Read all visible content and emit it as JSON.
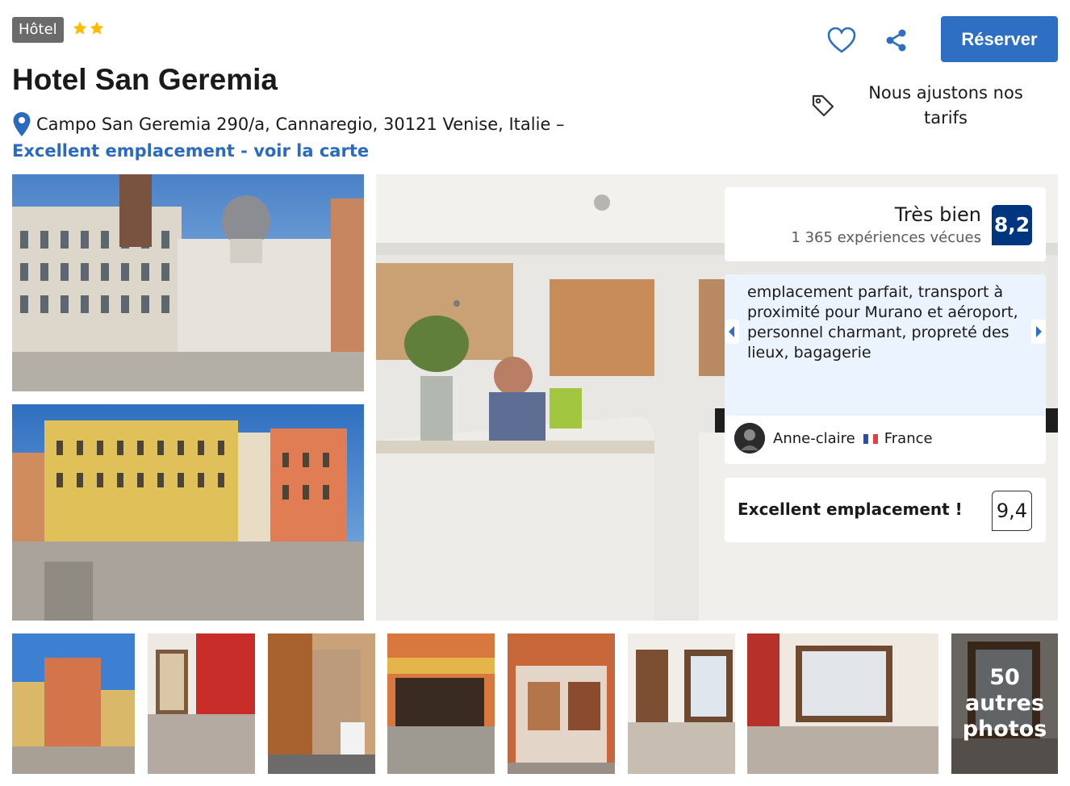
{
  "header": {
    "type_badge": "Hôtel",
    "star_rating": 2,
    "title": "Hotel San Geremia",
    "address": "Campo San Geremia 290/a, Cannaregio, 30121 Venise, Italie –",
    "map_link": "Excellent emplacement - voir la carte"
  },
  "actions": {
    "favorite_icon": "heart-icon",
    "share_icon": "share-icon",
    "reserve_label": "Réserver",
    "price_tag_icon": "tag-icon",
    "price_note": "Nous ajustons nos tarifs"
  },
  "review_summary": {
    "rating_word": "Très bien",
    "experiences": "1 365 expériences vécues",
    "score": "8,2"
  },
  "featured_review": {
    "text": "emplacement parfait, transport à proximité pour Murano et aéroport, personnel charmant, propreté des lieux, bagagerie",
    "reviewer_name": "Anne-claire",
    "reviewer_country": "France",
    "flag_icon": "flag-france-icon"
  },
  "location_score": {
    "label": "Excellent emplacement !",
    "score": "9,4"
  },
  "gallery": {
    "more_count": "50",
    "more_label_1": "autres",
    "more_label_2": "photos"
  },
  "colors": {
    "accent": "#2e6fc4",
    "link": "#2a6bbf",
    "score_badge": "#003580",
    "star": "#febb02",
    "quote_bg": "#ebf3ff"
  }
}
